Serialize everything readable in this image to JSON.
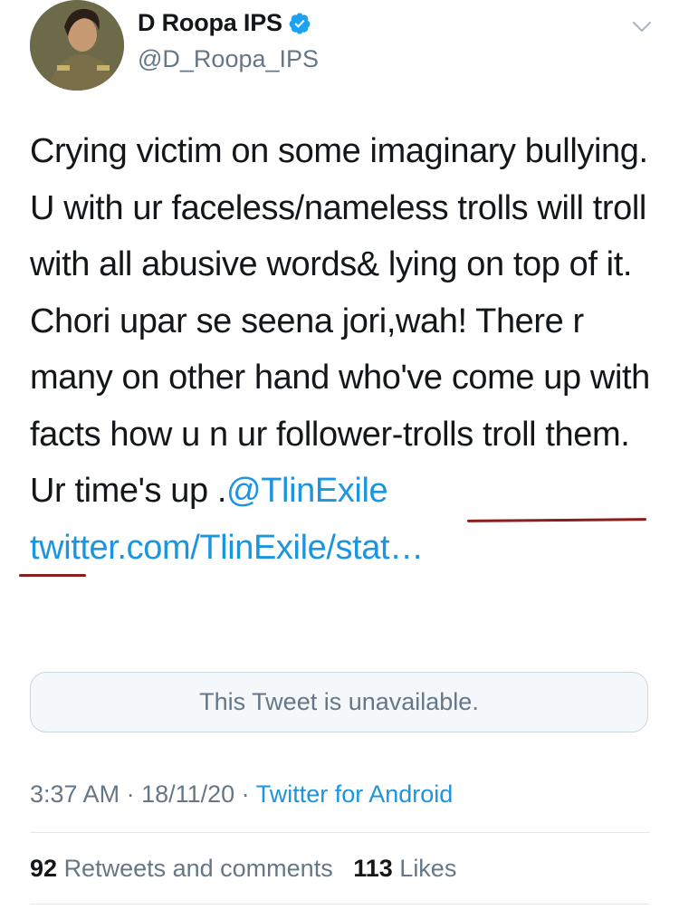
{
  "author": {
    "display_name": "D Roopa IPS",
    "handle": "@D_Roopa_IPS"
  },
  "tweet": {
    "text_main": "Crying victim on some imaginary bullying. U with ur faceless/nameless trolls will troll with all abusive words& lying on top of it. Chori upar se seena jori,wah! There r many on other hand who've come up with facts how u n ur follower-trolls troll them. Ur time's up .",
    "mention": "@TlinExile",
    "link": "twitter.com/TlinExile/stat…"
  },
  "quoted_tweet": {
    "message": "This Tweet is unavailable."
  },
  "meta": {
    "time": "3:37 AM",
    "separator1": " · ",
    "date": "18/11/20",
    "separator2": " · ",
    "source": "Twitter for Android"
  },
  "stats": {
    "retweets_count": "92",
    "retweets_label": "Retweets and comments",
    "likes_count": "113",
    "likes_label": "Likes"
  },
  "colors": {
    "link": "#1b95e0",
    "secondary_text": "#657786",
    "verified_badge": "#1da1f2",
    "annotation_underline": "#8b1d1d"
  },
  "icons": [
    "verified-badge-icon",
    "chevron-down-icon",
    "avatar"
  ]
}
